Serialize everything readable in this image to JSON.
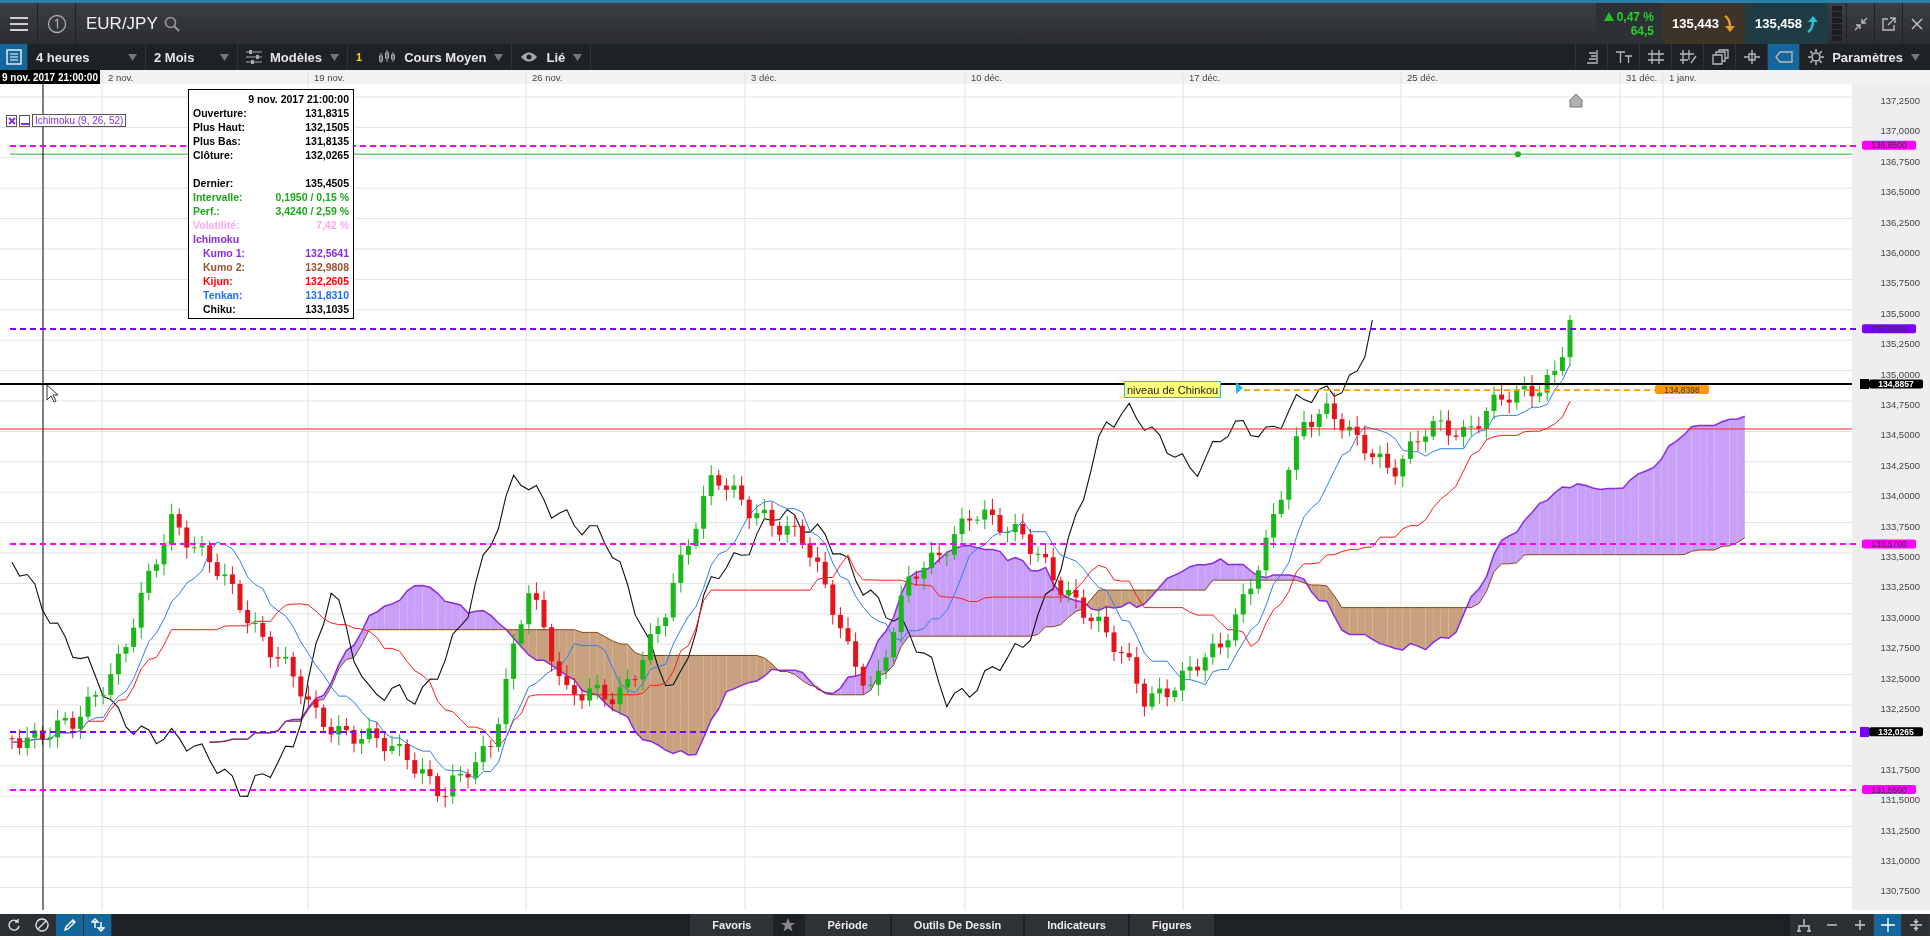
{
  "header": {
    "symbol": "EUR/JPY",
    "change": "0,47 %",
    "change_up": true,
    "points": "64,5",
    "bid": "135,443",
    "ask": "135,458"
  },
  "toolbar": {
    "interval": "4 heures",
    "range": "2 Mois",
    "templates": "Modèles",
    "count": "1",
    "chart_type": "Cours Moyen",
    "link": "Lié",
    "settings": "Paramètres",
    "tools": [
      {
        "kind": "scale",
        "selected": false
      },
      {
        "kind": "text",
        "selected": false
      },
      {
        "kind": "grid",
        "selected": false
      },
      {
        "kind": "draw",
        "selected": false
      },
      {
        "kind": "windows",
        "selected": false
      },
      {
        "kind": "cross",
        "selected": false
      },
      {
        "kind": "tag",
        "selected": true
      }
    ]
  },
  "date_axis": {
    "cursor": "9 nov. 2017 21:00:00",
    "labels": [
      "2 nov.",
      "19 nov.",
      "26 nov.",
      "3 déc.",
      "10 déc.",
      "17 déc.",
      "25 déc.",
      "31 déc.",
      "1 janv."
    ]
  },
  "price_axis": {
    "ticks": [
      "137,2500",
      "137,0000",
      "136,7500",
      "136,5000",
      "136,2500",
      "136,0000",
      "135,7500",
      "135,5000",
      "135,2500",
      "135,0000",
      "134,7500",
      "134,5000",
      "134,2500",
      "134,0000",
      "133,7500",
      "133,5000",
      "133,2500",
      "133,0000",
      "132,7500",
      "132,5000",
      "132,2500",
      "131,7500",
      "131,5000",
      "131,2500",
      "131,0000",
      "130,7500"
    ]
  },
  "levels": [
    {
      "label": "136,8500",
      "color": "#ff00ff",
      "kind": "dashed",
      "dark_tag": false
    },
    {
      "label": "135,3400",
      "color": "#7b00ff",
      "kind": "dashed",
      "dark_tag": false
    },
    {
      "label": "134,8857",
      "color": "#000000",
      "kind": "solid",
      "dark_tag": true
    },
    {
      "label": "134,8398",
      "color": "#ff9900",
      "kind": "short",
      "dark_tag": false
    },
    {
      "label": "133,5700",
      "color": "#ff00ff",
      "kind": "dashed",
      "dark_tag": false
    },
    {
      "label": "132,0265",
      "color": "#7b00ff",
      "kind": "dashed",
      "dark_tag": true
    },
    {
      "label": "131,5500",
      "color": "#ff00ff",
      "kind": "dashed",
      "dark_tag": false
    }
  ],
  "indicator": {
    "label": "Ichimoku (9, 26, 52)"
  },
  "tooltip": {
    "date": "9 nov. 2017 21:00:00",
    "price_rows": [
      {
        "label": "Ouverture:",
        "value": "131,8315",
        "color": "#000000"
      },
      {
        "label": "Plus Haut:",
        "value": "132,1505",
        "color": "#000000"
      },
      {
        "label": "Plus Bas:",
        "value": "131,8135",
        "color": "#000000"
      },
      {
        "label": "Clôture:",
        "value": "132,0265",
        "color": "#000000"
      }
    ],
    "stat_rows": [
      {
        "label": "Dernier:",
        "value": "135,4505",
        "color": "#000000"
      },
      {
        "label": "Intervalle:",
        "value": "0,1950 / 0,15 %",
        "color": "#1aa81a"
      },
      {
        "label": "Perf.:",
        "value": "3,4240 / 2,59 %",
        "color": "#1aa81a"
      },
      {
        "label": "Volatilité:",
        "value": "7,42 %",
        "color": "#ffa6f5"
      }
    ],
    "section": "Ichimoku",
    "section_rows": [
      {
        "label": "Kumo 1:",
        "value": "132,5641",
        "color": "#8a2be2"
      },
      {
        "label": "Kumo 2:",
        "value": "132,9808",
        "color": "#a0522d"
      },
      {
        "label": "Kijun:",
        "value": "132,2605",
        "color": "#ff0000"
      },
      {
        "label": "Tenkan:",
        "value": "131,8310",
        "color": "#1e6fff"
      },
      {
        "label": "Chiku:",
        "value": "133,1035",
        "color": "#000000"
      }
    ]
  },
  "chinkou_label": "niveau de Chinkou",
  "bottom_bar": {
    "left_tools": [
      {
        "kind": "refresh",
        "selected": false
      },
      {
        "kind": "cancel",
        "selected": false
      },
      {
        "kind": "pencil",
        "selected": true
      },
      {
        "kind": "arrows",
        "selected": true
      }
    ],
    "tabs": [
      "Favoris",
      "Période",
      "Outils De Dessin",
      "Indicateurs",
      "Figures"
    ],
    "right_tools": [
      {
        "kind": "tree",
        "selected": false
      },
      {
        "kind": "minus",
        "selected": false
      },
      {
        "kind": "plus",
        "selected": false
      },
      {
        "kind": "cross",
        "selected": true
      },
      {
        "kind": "split",
        "selected": false
      }
    ]
  }
}
